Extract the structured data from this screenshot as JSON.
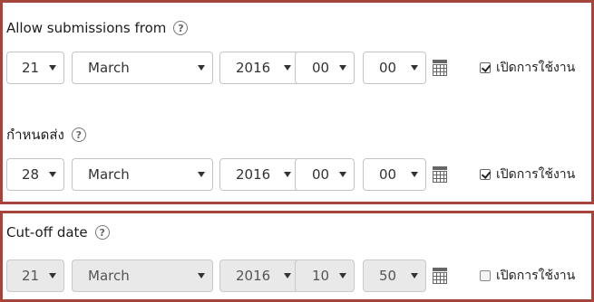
{
  "sections": [
    {
      "label": "Allow submissions from",
      "day": "21",
      "month": "March",
      "year": "2016",
      "hour": "00",
      "minute": "00",
      "enable_label": "เปิดการใช้งาน",
      "enabled": true
    },
    {
      "label": "กำหนดส่ง",
      "day": "28",
      "month": "March",
      "year": "2016",
      "hour": "00",
      "minute": "00",
      "enable_label": "เปิดการใช้งาน",
      "enabled": true
    },
    {
      "label": "Cut-off date",
      "day": "21",
      "month": "March",
      "year": "2016",
      "hour": "10",
      "minute": "50",
      "enable_label": "เปิดการใช้งาน",
      "enabled": false
    }
  ],
  "help_glyph": "?",
  "colors": {
    "highlight_border": "#a5443b",
    "disabled_bg": "#e9e9e9"
  }
}
